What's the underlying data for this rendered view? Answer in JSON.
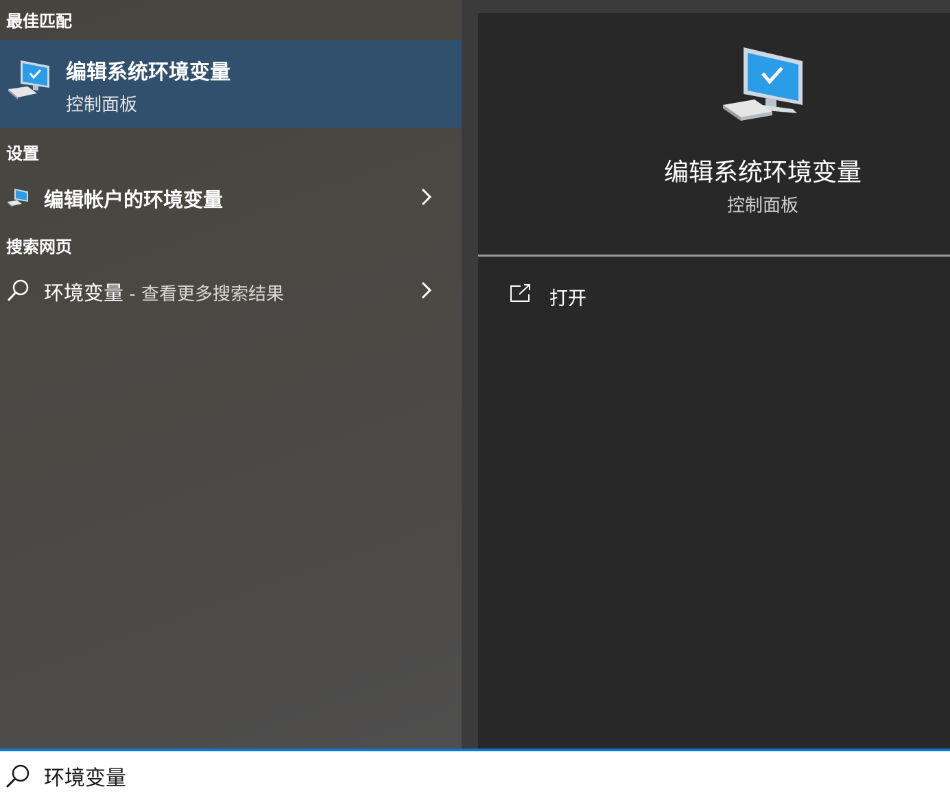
{
  "best_match": {
    "header": "最佳匹配",
    "title": "编辑系统环境变量",
    "subtitle": "控制面板",
    "icon": "monitor-checkmark-icon"
  },
  "settings": {
    "header": "设置",
    "items": [
      {
        "label": "编辑帐户的环境变量",
        "icon": "monitor-settings-icon"
      }
    ]
  },
  "web_search": {
    "header": "搜索网页",
    "query": "环境变量",
    "separator": " - ",
    "hint": "查看更多搜索结果",
    "icon": "search-icon"
  },
  "preview": {
    "title": "编辑系统环境变量",
    "subtitle": "控制面板",
    "actions": [
      {
        "label": "打开",
        "icon": "open-external-icon"
      }
    ]
  },
  "search_box": {
    "value": "环境变量",
    "icon": "search-icon"
  },
  "colors": {
    "selected_row": "#30506d",
    "accent": "#0c78d4",
    "preview_bg": "#282828"
  }
}
